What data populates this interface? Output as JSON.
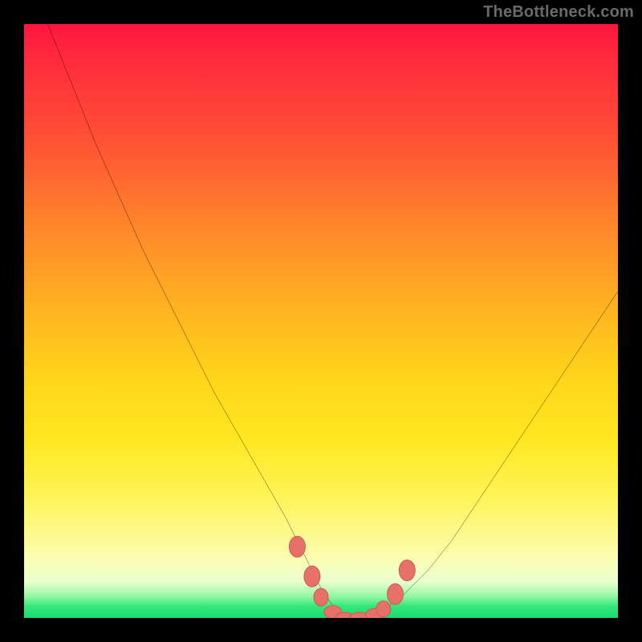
{
  "watermark": "TheBottleneck.com",
  "colors": {
    "frame": "#000000",
    "curve": "#000000",
    "marker_fill": "#e77169",
    "marker_stroke": "#cf5a53",
    "gradient_stops": [
      "#ff153e",
      "#ff5234",
      "#ffb321",
      "#ffe720",
      "#fbfcb0",
      "#35e879"
    ]
  },
  "chart_data": {
    "type": "line",
    "title": "",
    "xlabel": "",
    "ylabel": "",
    "xlim": [
      0,
      100
    ],
    "ylim": [
      0,
      100
    ],
    "grid": false,
    "series": [
      {
        "name": "bottleneck-curve",
        "x": [
          4,
          8,
          12,
          16,
          20,
          24,
          28,
          32,
          36,
          40,
          44,
          46,
          48,
          50,
          52,
          54,
          56,
          58,
          60,
          64,
          68,
          72,
          76,
          80,
          84,
          88,
          92,
          96,
          100
        ],
        "y": [
          100,
          90,
          80,
          71,
          62,
          54,
          46,
          38,
          31,
          24,
          17,
          13,
          9,
          5,
          2,
          0,
          0,
          0,
          1,
          4,
          8,
          13,
          19,
          25,
          31,
          37,
          43,
          49,
          55
        ]
      }
    ],
    "markers": {
      "name": "highlight-points",
      "x": [
        46.0,
        48.5,
        50.0,
        52.0,
        54.0,
        56.5,
        59.0,
        60.5,
        62.5,
        64.5
      ],
      "y": [
        12.0,
        7.0,
        3.5,
        1.0,
        0.0,
        0.0,
        0.5,
        1.5,
        4.0,
        8.0
      ]
    }
  }
}
